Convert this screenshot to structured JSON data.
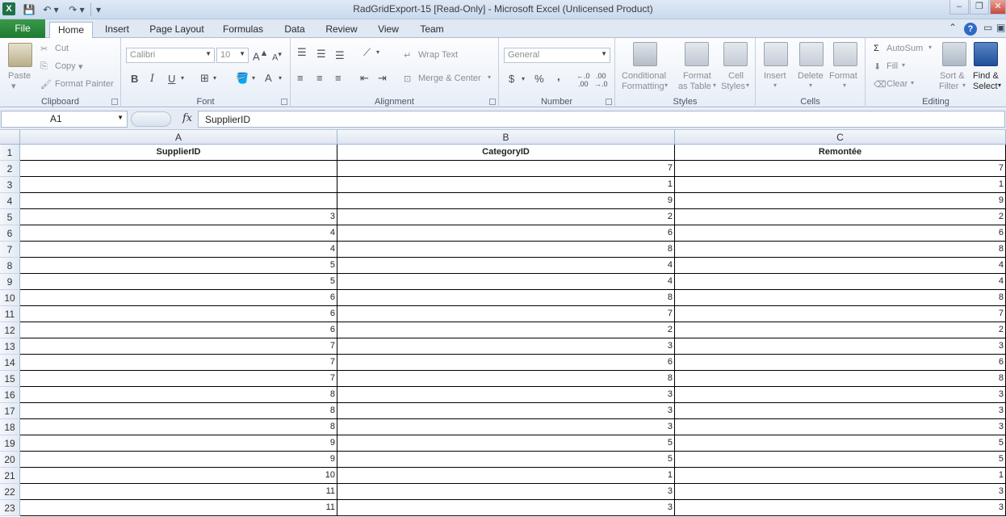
{
  "window": {
    "title": "RadGridExport-15  [Read-Only]  -  Microsoft Excel (Unlicensed Product)",
    "minimize": "–",
    "restore": "❐",
    "close": "✕"
  },
  "tabs": {
    "file": "File",
    "items": [
      "Home",
      "Insert",
      "Page Layout",
      "Formulas",
      "Data",
      "Review",
      "View",
      "Team"
    ],
    "active": "Home"
  },
  "ribbon": {
    "clipboard": {
      "label": "Clipboard",
      "paste": "Paste",
      "cut": "Cut",
      "copy": "Copy",
      "format_painter": "Format Painter"
    },
    "font": {
      "label": "Font",
      "font_name": "Calibri",
      "font_size": "10",
      "bold": "B",
      "italic": "I",
      "underline": "U"
    },
    "alignment": {
      "label": "Alignment",
      "wrap_text": "Wrap Text",
      "merge_center": "Merge & Center"
    },
    "number": {
      "label": "Number",
      "format": "General",
      "currency": "$",
      "percent": "%",
      "comma": ","
    },
    "styles": {
      "label": "Styles",
      "conditional_1": "Conditional",
      "conditional_2": "Formatting",
      "format_table_1": "Format",
      "format_table_2": "as Table",
      "cell_styles_1": "Cell",
      "cell_styles_2": "Styles"
    },
    "cells": {
      "label": "Cells",
      "insert": "Insert",
      "delete": "Delete",
      "format": "Format"
    },
    "editing": {
      "label": "Editing",
      "autosum": "AutoSum",
      "fill": "Fill",
      "clear": "Clear",
      "sort_1": "Sort &",
      "sort_2": "Filter",
      "find_1": "Find &",
      "find_2": "Select"
    }
  },
  "formula_bar": {
    "name_box": "A1",
    "fx": "fx",
    "value": "SupplierID"
  },
  "sheet": {
    "columns": [
      "A",
      "B",
      "C"
    ],
    "headers": [
      "SupplierID",
      "CategoryID",
      "Remontée"
    ],
    "rows": [
      [
        "",
        "7",
        "7"
      ],
      [
        "",
        "1",
        "1"
      ],
      [
        "",
        "9",
        "9"
      ],
      [
        "3",
        "2",
        "2"
      ],
      [
        "4",
        "6",
        "6"
      ],
      [
        "4",
        "8",
        "8"
      ],
      [
        "5",
        "4",
        "4"
      ],
      [
        "5",
        "4",
        "4"
      ],
      [
        "6",
        "8",
        "8"
      ],
      [
        "6",
        "7",
        "7"
      ],
      [
        "6",
        "2",
        "2"
      ],
      [
        "7",
        "3",
        "3"
      ],
      [
        "7",
        "6",
        "6"
      ],
      [
        "7",
        "8",
        "8"
      ],
      [
        "8",
        "3",
        "3"
      ],
      [
        "8",
        "3",
        "3"
      ],
      [
        "8",
        "3",
        "3"
      ],
      [
        "9",
        "5",
        "5"
      ],
      [
        "9",
        "5",
        "5"
      ],
      [
        "10",
        "1",
        "1"
      ],
      [
        "11",
        "3",
        "3"
      ],
      [
        "11",
        "3",
        "3"
      ]
    ],
    "row_numbers": [
      "1",
      "2",
      "3",
      "4",
      "5",
      "6",
      "7",
      "8",
      "9",
      "10",
      "11",
      "12",
      "13",
      "14",
      "15",
      "16",
      "17",
      "18",
      "19",
      "20",
      "21",
      "22",
      "23"
    ]
  }
}
